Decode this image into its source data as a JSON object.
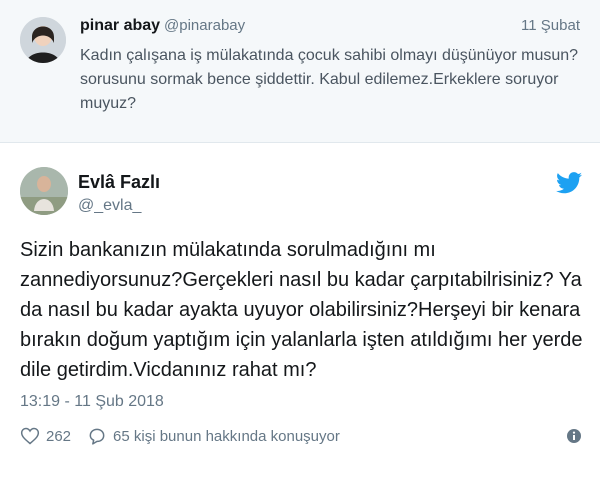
{
  "quoted_tweet": {
    "name": "pinar abay",
    "handle": "@pinarabay",
    "date": "11 Şubat",
    "text": "Kadın çalışana iş mülakatında çocuk sahibi olmayı düşünüyor musun? sorusunu sormak bence şiddettir. Kabul edilemez.Erkeklere soruyor muyuz?"
  },
  "main_tweet": {
    "name": "Evlâ Fazlı",
    "handle": "@_evla_",
    "text": "Sizin bankanızın mülakatında sorulmadığını mı zannediyorsunuz?Gerçekleri nasıl bu kadar çarpıtabilrisiniz? Ya da nasıl bu kadar ayakta uyuyor olabilirsiniz?Herşeyi bir kenara bırakın doğum yaptığım için yalanlarla işten atıldığımı her yerde dile getirdim.Vicdanınız rahat mı?",
    "timestamp": "13:19 - 11 Şub 2018",
    "likes": "262",
    "replies_text": "65 kişi bunun hakkında konuşuyor"
  },
  "colors": {
    "twitter_blue": "#1da1f2",
    "secondary_text": "#657786",
    "quoted_bg": "#f5f8fa"
  },
  "icons": [
    "heart-icon",
    "comment-icon",
    "twitter-bird-icon",
    "info-icon"
  ]
}
